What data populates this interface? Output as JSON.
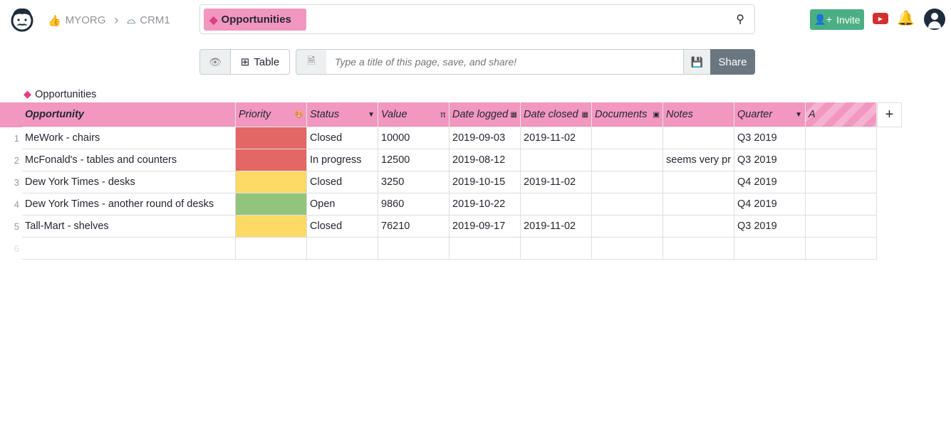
{
  "breadcrumb": {
    "org": "MYORG",
    "doc": "CRM1"
  },
  "search": {
    "page_tag": "Opportunities"
  },
  "header": {
    "invite": "Invite"
  },
  "toolbar": {
    "view": "Table",
    "title_placeholder": "Type a title of this page, save, and share!",
    "share": "Share"
  },
  "table": {
    "title": "Opportunities",
    "columns": [
      "Opportunity",
      "Priority",
      "Status",
      "Value",
      "Date logged",
      "Date closed",
      "Documents",
      "Notes",
      "Quarter",
      "A"
    ],
    "rows": [
      {
        "n": "1",
        "opportunity": "MeWork - chairs",
        "priority": "#e36765",
        "status": "Closed",
        "value": "10000",
        "logged": "2019-09-03",
        "closed": "2019-11-02",
        "documents": "",
        "notes": "",
        "quarter": "Q3 2019"
      },
      {
        "n": "2",
        "opportunity": "McFonald's - tables and counters",
        "priority": "#e36765",
        "status": "In progress",
        "value": "12500",
        "logged": "2019-08-12",
        "closed": "",
        "documents": "",
        "notes": "seems very pr",
        "quarter": "Q3 2019"
      },
      {
        "n": "3",
        "opportunity": "Dew York Times - desks",
        "priority": "#fdd965",
        "status": "Closed",
        "value": "3250",
        "logged": "2019-10-15",
        "closed": "2019-11-02",
        "documents": "",
        "notes": "",
        "quarter": "Q4 2019"
      },
      {
        "n": "4",
        "opportunity": "Dew York Times - another round of desks",
        "priority": "#93c47d",
        "status": "Open",
        "value": "9860",
        "logged": "2019-10-22",
        "closed": "",
        "documents": "",
        "notes": "",
        "quarter": "Q4 2019"
      },
      {
        "n": "5",
        "opportunity": "Tall-Mart - shelves",
        "priority": "#fdd965",
        "status": "Closed",
        "value": "76210",
        "logged": "2019-09-17",
        "closed": "2019-11-02",
        "documents": "",
        "notes": "",
        "quarter": "Q3 2019"
      }
    ],
    "new_row_number": "6"
  },
  "colors": {
    "accent": "#f197c0",
    "invite": "#4caf84",
    "share": "#6b7780"
  }
}
